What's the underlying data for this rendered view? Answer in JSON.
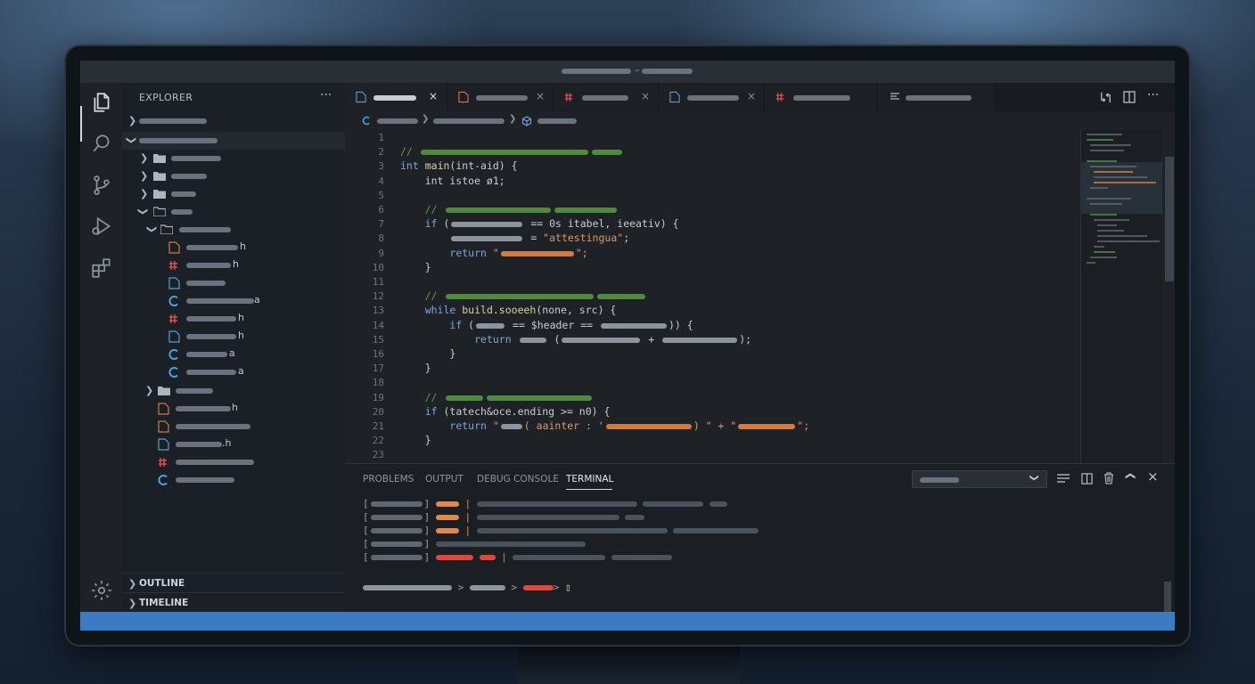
{
  "window": {
    "title_separator": "–"
  },
  "sidebar": {
    "title": "EXPLORER",
    "more": "···",
    "file_suffixes": [
      "h",
      "h",
      "a",
      "h",
      "h",
      "a",
      "a",
      "h",
      ".h"
    ],
    "sections": [
      "OUTLINE",
      "TIMELINE"
    ]
  },
  "tabs": {
    "close": "×"
  },
  "code": {
    "line_numbers": [
      "1",
      "2",
      "3",
      "4",
      "5",
      "6",
      "7",
      "8",
      "9",
      "10",
      "11",
      "12",
      "13",
      "14",
      "15",
      "16",
      "17",
      "18",
      "19",
      "20",
      "21",
      "22",
      "23"
    ],
    "l3_kw": "int",
    "l3_fn": "main",
    "l3_rest": "(int-aid) {",
    "l4": "    int istoe ø1;",
    "l7_kw": "if",
    "l7_open": " (",
    "l7_rest": " == 0s itabel, ieeativ) {",
    "l8_rest": " = ",
    "l8_str": "\"attestingua\"",
    "l8_end": ";",
    "l9_kw": "return",
    "l9_q1": " \"",
    "l9_q2": "\";",
    "l10": "    }",
    "l13_kw": "while",
    "l13_fn": " build.sooeeh",
    "l13_rest": "(none, src) {",
    "l14_kw": "if",
    "l14_open": " (",
    "l14_mid": " == $header == ",
    "l14_end": ")) {",
    "l15_kw": "return",
    "l15_open": " (",
    "l15_plus": " + ",
    "l15_end": ");",
    "l16": "        }",
    "l17": "    }",
    "l20_kw": "if",
    "l20_rest": " (tatech&oce.ending >= n0) {",
    "l21_kw": "return",
    "l21_s1": " \"",
    "l21_s2": "( aainter : '",
    "l21_s3": ") \" + \"",
    "l21_s4": "\";",
    "l22": "    }",
    "comment_prefix": "//"
  },
  "panel": {
    "tabs": [
      "PROBLEMS",
      "OUTPUT",
      "DEBUG CONSOLE",
      "TERMINAL"
    ],
    "active_tab": "TERMINAL",
    "bracket_open": "[",
    "bracket_close": "]",
    "prompt_sep": ">",
    "cursor": "▯"
  },
  "colors": {
    "accent": "#3b7bc4",
    "comment": "#5a9a4a",
    "string": "#d39b6b",
    "keyword": "#7aa6d9",
    "orange_badge": "#e0894a",
    "red_badge": "#e0483c"
  }
}
